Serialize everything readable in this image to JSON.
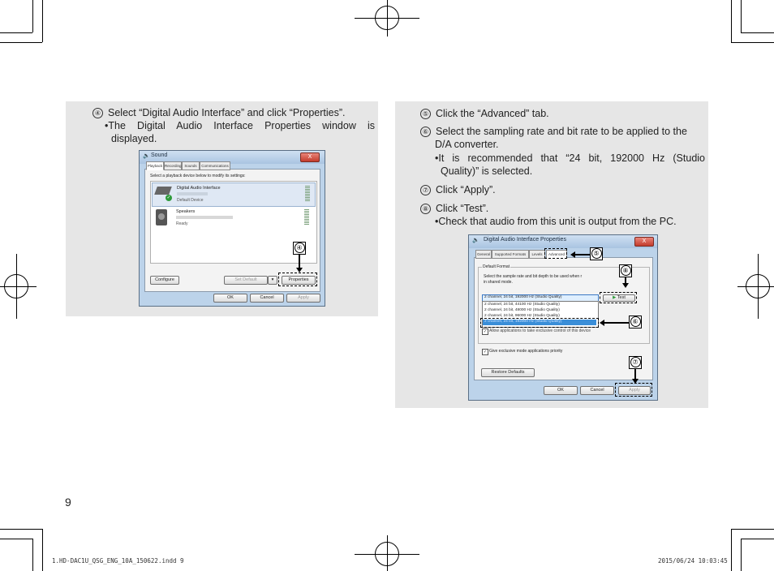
{
  "page_number": "9",
  "footer": {
    "file": "1.HD-DAC1U_QSG_ENG_10A_150622.indd   9",
    "date": "2015/06/24   10:03:45"
  },
  "left_panel": {
    "step4_num": "④",
    "step4_text": "Select “Digital Audio Interface” and click “Properties”.",
    "bullet_line1": "•The Digital Audio Interface Properties window is",
    "bullet_line2": "displayed.",
    "sound_dialog": {
      "title": "Sound",
      "close": "X",
      "tabs": [
        "Playback",
        "Recording",
        "Sounds",
        "Communications"
      ],
      "instruction": "Select a playback device below to modify its settings:",
      "device1_name": "Digital Audio Interface",
      "device1_status": "Default Device",
      "device2_name": "Speakers",
      "device2_status": "Ready",
      "configure": "Configure",
      "set_default": "Set Default",
      "properties": "Properties",
      "ok": "OK",
      "cancel": "Cancel",
      "apply": "Apply",
      "callout": "④"
    }
  },
  "right_panel": {
    "step5_num": "⑤",
    "step5_text": "Click the “Advanced” tab.",
    "step6_num": "⑥",
    "step6_line1": "Select the sampling rate and bit rate to be applied to the",
    "step6_line2": "D/A converter.",
    "bullet1_line1": "•It is recommended that “24 bit, 192000 Hz (Studio",
    "bullet1_line2": "Quality)” is selected.",
    "step7_num": "⑦",
    "step7_text": "Click “Apply”.",
    "step8_num": "⑧",
    "step8_text": "Click “Test”.",
    "bullet2": "•Check that audio from this unit is output from the PC.",
    "props_dialog": {
      "title": "Digital Audio Interface Properties",
      "close": "X",
      "tabs": [
        "General",
        "Supported Formats",
        "Levels",
        "Advanced"
      ],
      "group_label": "Default Format",
      "desc_line1": "Select the sample rate and bit depth to be used when r",
      "desc_line2": "in shared mode.",
      "selected_format": "2 channel, 24 bit, 192000 Hz (Studio Quality)",
      "test": "Test",
      "formats": [
        "2 channel, 24 bit, 44100 Hz (Studio Quality)",
        "2 channel, 24 bit, 48000 Hz (Studio Quality)",
        "2 channel, 24 bit, 96000 Hz (Studio Quality)",
        "2 channel, 24 bit, 192000 Hz (Studio Quality)"
      ],
      "exclusive_control": "Allow applications to take exclusive control of this device",
      "exclusive_priority": "Give exclusive mode applications priority",
      "restore": "Restore Defaults",
      "ok": "OK",
      "cancel": "Cancel",
      "apply": "Apply",
      "callout5": "⑤",
      "callout6": "⑥",
      "callout7": "⑦",
      "callout8": "⑧"
    }
  }
}
